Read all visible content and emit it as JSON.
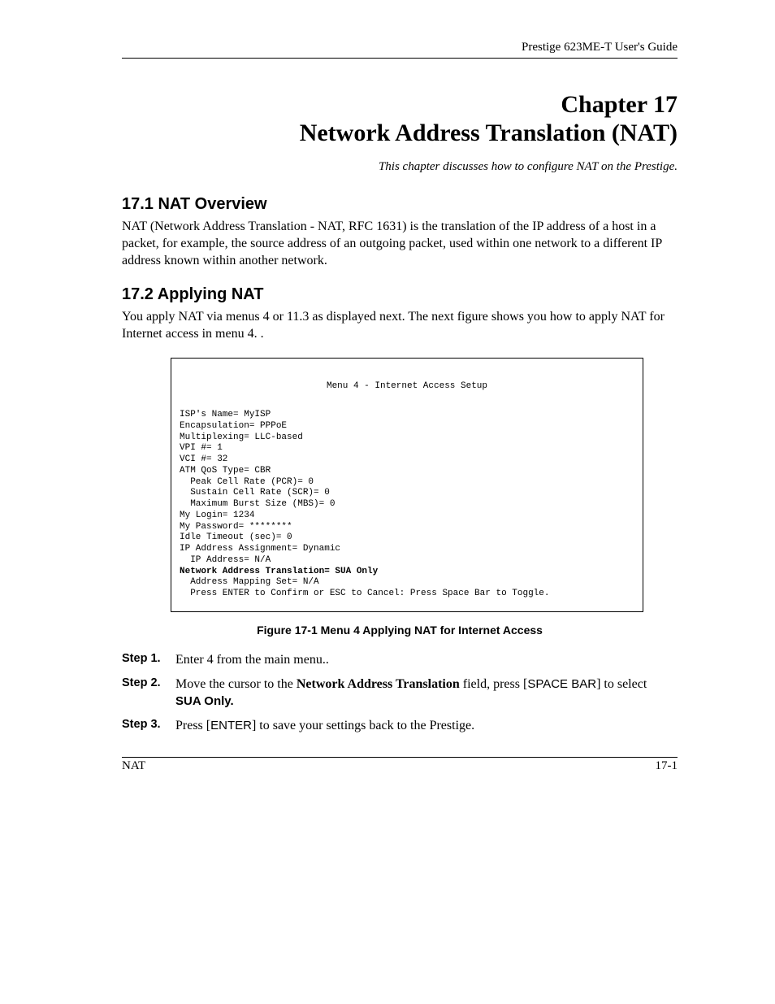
{
  "header": {
    "guide": "Prestige 623ME-T User's Guide"
  },
  "chapter": {
    "number_line": "Chapter 17",
    "title_line": "Network Address Translation (NAT)",
    "subtitle": "This chapter discusses how to configure NAT on the Prestige."
  },
  "sections": {
    "s1": {
      "heading": "17.1  NAT Overview",
      "body": "NAT (Network Address Translation - NAT, RFC 1631) is the translation of the IP address of a host in a packet, for example, the source address of an outgoing packet, used within one network to a different IP address known within another network."
    },
    "s2": {
      "heading": "17.2  Applying NAT",
      "body": "You apply NAT via menus 4 or 11.3 as displayed next. The next figure shows you how to apply NAT for Internet access in menu 4. ."
    }
  },
  "menu": {
    "title": "Menu 4 - Internet Access Setup",
    "lines": {
      "isp": "ISP's Name= MyISP",
      "encap": "Encapsulation= PPPoE",
      "mux": "Multiplexing= LLC-based",
      "vpi": "VPI #= 1",
      "vci": "VCI #= 32",
      "qos": "ATM QoS Type= CBR",
      "pcr": "  Peak Cell Rate (PCR)= 0",
      "scr": "  Sustain Cell Rate (SCR)= 0",
      "mbs": "  Maximum Burst Size (MBS)= 0",
      "login": "My Login= 1234",
      "pass": "My Password= ********",
      "idle": "Idle Timeout (sec)= 0",
      "ipassign": "IP Address Assignment= Dynamic",
      "ipaddr": "  IP Address= N/A",
      "nat": "Network Address Translation= SUA Only",
      "mapset": "  Address Mapping Set= N/A",
      "prompt": "  Press ENTER to Confirm or ESC to Cancel: Press Space Bar to Toggle."
    }
  },
  "figure_caption": "Figure 17-1 Menu 4 Applying NAT for Internet Access",
  "steps": {
    "s1": {
      "label": "Step 1.",
      "text": "Enter 4 from the main menu.."
    },
    "s2": {
      "label": "Step 2.",
      "pre": "Move the cursor to the ",
      "field": "Network Address Translation",
      "mid": " field, press [",
      "key": "SPACE BAR",
      "post": "] to select",
      "line2": "SUA Only."
    },
    "s3": {
      "label": "Step 3.",
      "pre": "Press [",
      "key": "ENTER",
      "post": "] to save your settings back to the Prestige."
    }
  },
  "footer": {
    "left": "NAT",
    "right": "17-1"
  }
}
